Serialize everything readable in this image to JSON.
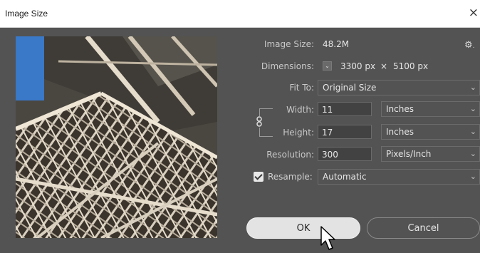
{
  "window": {
    "title": "Image Size",
    "close_glyph": "×"
  },
  "info": {
    "image_size_label": "Image Size:",
    "image_size_value": "48.2M",
    "dimensions_label": "Dimensions:",
    "dimensions_width": "3300 px",
    "dimensions_times": "×",
    "dimensions_height": "5100 px"
  },
  "fit_to": {
    "label": "Fit To:",
    "value": "Original Size"
  },
  "width": {
    "label": "Width:",
    "value": "11",
    "unit": "Inches"
  },
  "height": {
    "label": "Height:",
    "value": "17",
    "unit": "Inches"
  },
  "resolution": {
    "label": "Resolution:",
    "value": "300",
    "unit": "Pixels/Inch"
  },
  "resample": {
    "label": "Resample:",
    "checked": true,
    "value": "Automatic"
  },
  "buttons": {
    "ok": "OK",
    "cancel": "Cancel"
  },
  "icons": {
    "gear": "gear-icon",
    "chain": "chain-link-icon",
    "chevron": "chevron-down-icon",
    "cursor": "mouse-pointer-icon"
  },
  "colors": {
    "dialog_bg": "#535353",
    "sky_blue": "#3a78c8"
  }
}
